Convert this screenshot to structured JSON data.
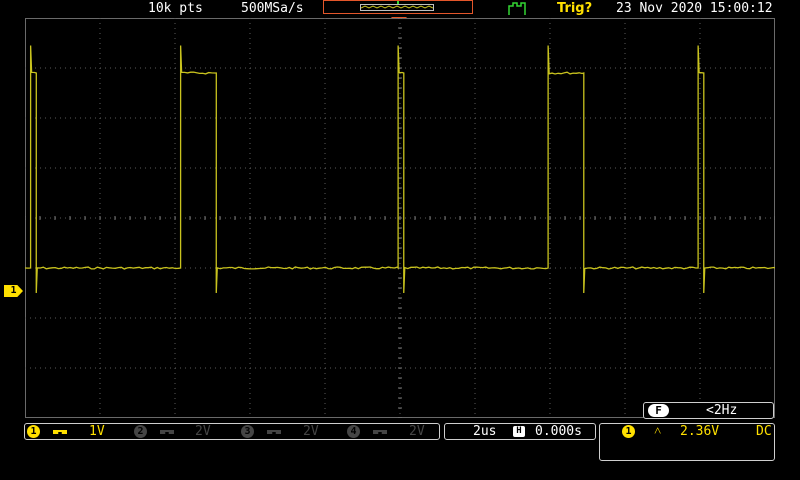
{
  "header": {
    "record_length": "10k pts",
    "sample_rate": "500MSa/s",
    "trigger_status": "Trig?",
    "datetime": "23 Nov 2020 15:00:12",
    "run_icon": "run-waveform-icon"
  },
  "side": {
    "channel_marker": "1"
  },
  "frequency_counter": {
    "badge": "F",
    "value": "<2Hz"
  },
  "channels": [
    {
      "num": "1",
      "coupling_icon": "dc-coupling-icon",
      "scale": "1V",
      "color": "#ffe000"
    },
    {
      "num": "2",
      "coupling_icon": "dc-coupling-icon",
      "scale": "2V",
      "color": "#454545"
    },
    {
      "num": "3",
      "coupling_icon": "dc-coupling-icon",
      "scale": "2V",
      "color": "#454545"
    },
    {
      "num": "4",
      "coupling_icon": "dc-coupling-icon",
      "scale": "2V",
      "color": "#454545"
    }
  ],
  "timebase": {
    "scale": "2us",
    "badge": "H",
    "position": "0.000s"
  },
  "trigger": {
    "source": "1",
    "slope_icon": "rising-edge-icon",
    "level": "2.36V",
    "coupling": "DC"
  },
  "colors": {
    "trace": "#c9c31e",
    "accent": "#ffe000",
    "trig_marker": "#e3562a",
    "run_green": "#33d633",
    "grid": "#5a5a5a"
  },
  "waveform": {
    "type": "square-pulse-train",
    "low_level_divs": -1.0,
    "high_level_divs": 2.9,
    "pulse_edges_us": [
      [
        -9.85,
        -9.7
      ],
      [
        -5.85,
        -4.9
      ],
      [
        -0.05,
        0.1
      ],
      [
        3.95,
        4.9
      ],
      [
        7.95,
        8.1
      ]
    ]
  }
}
